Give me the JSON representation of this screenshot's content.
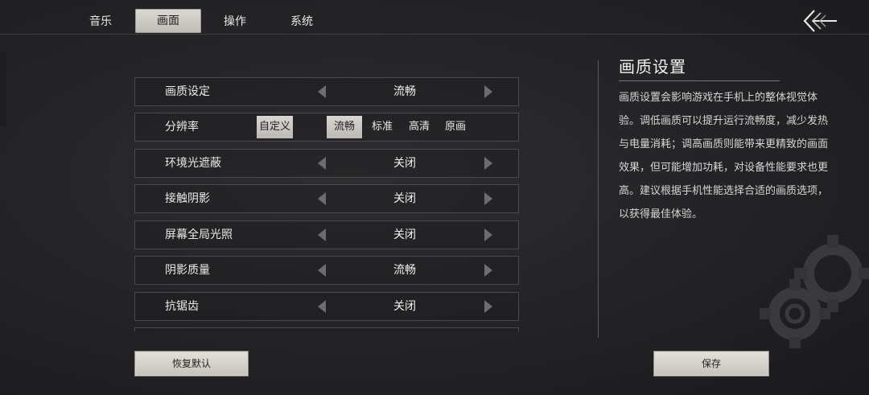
{
  "tabs": [
    {
      "label": "音乐",
      "active": false
    },
    {
      "label": "画面",
      "active": true
    },
    {
      "label": "操作",
      "active": false
    },
    {
      "label": "系统",
      "active": false
    }
  ],
  "settings": {
    "rows": [
      {
        "label": "画质设定",
        "value": "流畅"
      },
      {
        "label": "分辨率",
        "custom_label": "自定义",
        "options": [
          "流畅",
          "标准",
          "高清",
          "原画"
        ],
        "selected": "流畅"
      },
      {
        "label": "环境光遮蔽",
        "value": "关闭"
      },
      {
        "label": "接触阴影",
        "value": "关闭"
      },
      {
        "label": "屏幕全局光照",
        "value": "关闭"
      },
      {
        "label": "阴影质量",
        "value": "流畅"
      },
      {
        "label": "抗锯齿",
        "value": "关闭"
      }
    ]
  },
  "info": {
    "title": "画质设置",
    "text": "画质设置会影响游戏在手机上的整体视觉体验。调低画质可以提升运行流畅度，减少发热与电量消耗；调高画质则能带来更精致的画面效果，但可能增加功耗，对设备性能要求也更高。建议根据手机性能选择合适的画质选项，以获得最佳体验。"
  },
  "footer": {
    "reset_label": "恢复默认",
    "save_label": "保存"
  },
  "icons": {
    "back": "back-arrow-icon",
    "gear": "gear-decoration-icon"
  }
}
